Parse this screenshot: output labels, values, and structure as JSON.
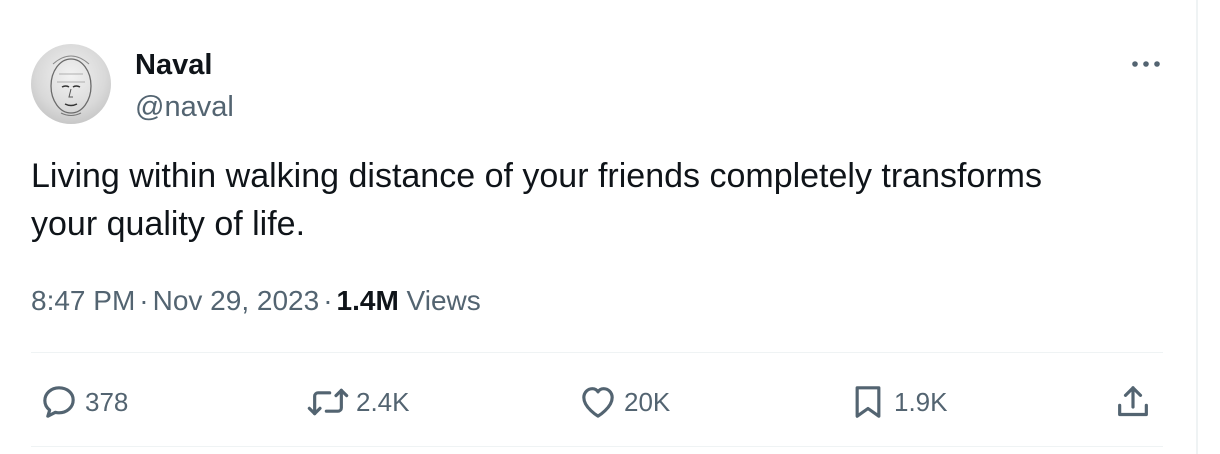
{
  "author": {
    "display_name": "Naval",
    "handle": "@naval",
    "avatar_icon": "profile-photo-sketch-face"
  },
  "tweet": {
    "text": "Living within walking distance of your friends completely transforms\nyour quality of life."
  },
  "meta": {
    "time": "8:47 PM",
    "separator": "·",
    "date": "Nov 29, 2023",
    "views_count": "1.4M",
    "views_label": "Views"
  },
  "actions": {
    "reply": {
      "icon": "reply-bubble-icon",
      "count": "378"
    },
    "retweet": {
      "icon": "retweet-icon",
      "count": "2.4K"
    },
    "like": {
      "icon": "heart-icon",
      "count": "20K"
    },
    "bookmark": {
      "icon": "bookmark-icon",
      "count": "1.9K"
    },
    "share": {
      "icon": "share-icon"
    }
  },
  "more": {
    "icon": "more-dots-icon"
  },
  "colors": {
    "text_primary": "#0f1419",
    "text_secondary": "#536471",
    "divider": "#eff3f4"
  }
}
